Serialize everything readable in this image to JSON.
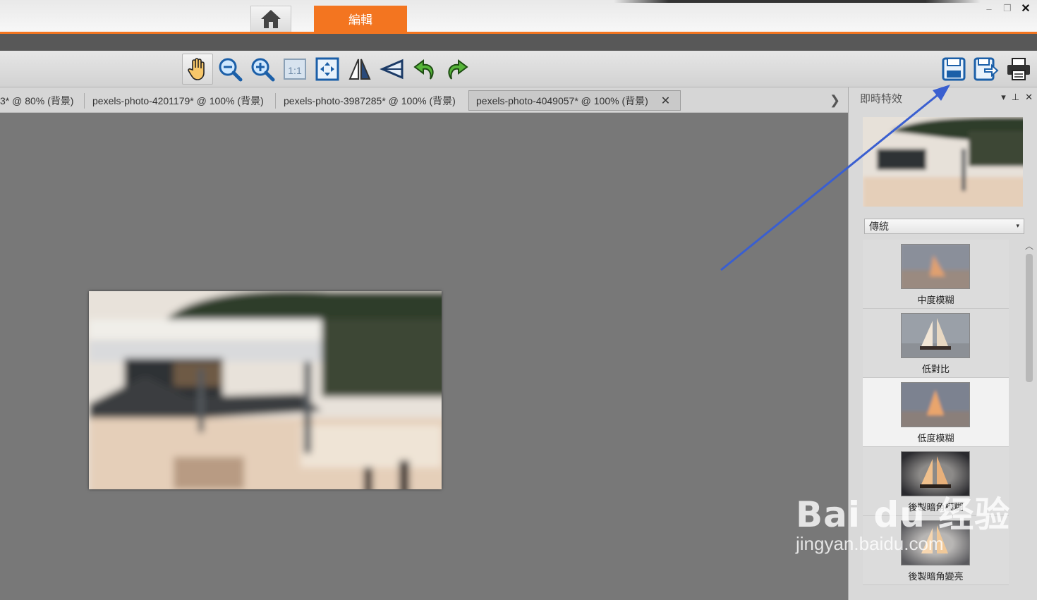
{
  "titlebar": {
    "edit_tab_label": "編輯",
    "home_icon": "home-icon",
    "minimize_glyph": "–",
    "restore_glyph": "❐",
    "close_glyph": "✕"
  },
  "toolbar": {
    "tools": [
      "hand-tool-icon",
      "zoom-out-icon",
      "zoom-in-icon",
      "actual-size-icon",
      "fit-screen-icon",
      "flip-icon",
      "perspective-icon",
      "undo-icon",
      "redo-icon"
    ],
    "actual_size_label": "1:1",
    "right_tools": [
      "save-icon",
      "save-as-icon",
      "print-icon"
    ]
  },
  "doc_tabs": [
    {
      "label": "3* @  80% (背景)",
      "active": false
    },
    {
      "label": "pexels-photo-4201179* @ 100% (背景)",
      "active": false
    },
    {
      "label": "pexels-photo-3987285* @ 100% (背景)",
      "active": false
    },
    {
      "label": "pexels-photo-4049057* @ 100% (背景)",
      "active": true
    }
  ],
  "doc_tab_close": "✕",
  "tab_scroll_glyph": "❯",
  "panel": {
    "title": "即時特效",
    "controls": [
      "▾",
      "⊥",
      "✕"
    ],
    "dropdown_value": "傳統",
    "dropdown_arrow": "▾",
    "effects": [
      {
        "label": "中度模糊",
        "selected": false
      },
      {
        "label": "低對比",
        "selected": false
      },
      {
        "label": "低度模糊",
        "selected": true
      },
      {
        "label": "後製暗角模糊",
        "selected": false
      },
      {
        "label": "後製暗角變亮",
        "selected": false
      }
    ],
    "scroll_up_glyph": "︿"
  },
  "watermark": {
    "brand": "Bai du 经验",
    "url": "jingyan.baidu.com"
  },
  "colors": {
    "accent": "#f37520",
    "annotation_arrow": "#3a5fd0"
  }
}
